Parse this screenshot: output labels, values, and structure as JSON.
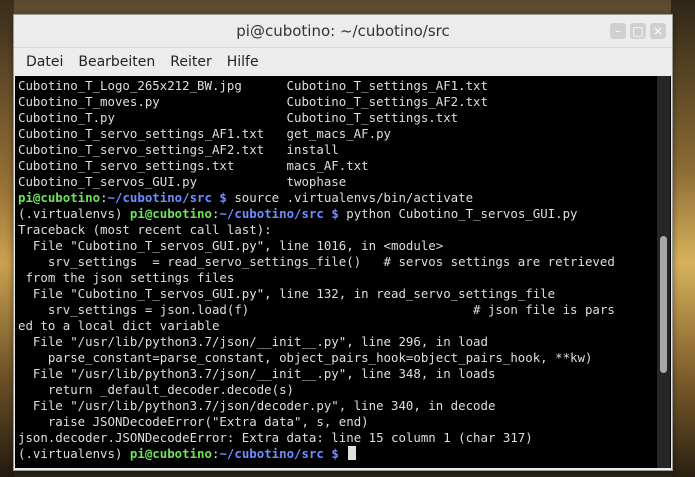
{
  "window": {
    "title": "pi@cubotino: ~/cubotino/src"
  },
  "menu": [
    "Datei",
    "Bearbeiten",
    "Reiter",
    "Hilfe"
  ],
  "terminal": {
    "ls_rows": [
      [
        "Cubotino_T_Logo_265x212_BW.jpg",
        "Cubotino_T_settings_AF1.txt"
      ],
      [
        "Cubotino_T_moves.py",
        "Cubotino_T_settings_AF2.txt"
      ],
      [
        "Cubotino_T.py",
        "Cubotino_T_settings.txt"
      ],
      [
        "Cubotino_T_servo_settings_AF1.txt",
        "get_macs_AF.py"
      ],
      [
        "Cubotino_T_servo_settings_AF2.txt",
        "install"
      ],
      [
        "Cubotino_T_servo_settings.txt",
        "macs_AF.txt"
      ],
      [
        "Cubotino_T_servos_GUI.py",
        "twophase"
      ]
    ],
    "prompt_user": "pi@cubotino",
    "prompt_path": "~/cubotino/src $",
    "venv": "(.virtualenvs)",
    "cmd1": " source .virtualenvs/bin/activate",
    "cmd2": " python Cubotino_T_servos_GUI.py",
    "output": [
      "Traceback (most recent call last):",
      "  File \"Cubotino_T_servos_GUI.py\", line 1016, in <module>",
      "    srv_settings  = read_servo_settings_file()   # servos settings are retrieved",
      " from the json settings files",
      "  File \"Cubotino_T_servos_GUI.py\", line 132, in read_servo_settings_file",
      "    srv_settings = json.load(f)                              # json file is pars",
      "ed to a local dict variable",
      "  File \"/usr/lib/python3.7/json/__init__.py\", line 296, in load",
      "    parse_constant=parse_constant, object_pairs_hook=object_pairs_hook, **kw)",
      "  File \"/usr/lib/python3.7/json/__init__.py\", line 348, in loads",
      "    return _default_decoder.decode(s)",
      "  File \"/usr/lib/python3.7/json/decoder.py\", line 340, in decode",
      "    raise JSONDecodeError(\"Extra data\", s, end)",
      "json.decoder.JSONDecodeError: Extra data: line 15 column 1 (char 317)"
    ],
    "scroll": {
      "position": 0.62,
      "visible_fraction": 0.35
    }
  },
  "colors": {
    "prompt_user": "#6ee25a",
    "prompt_path": "#6d8fff",
    "text": "#dedede",
    "background": "#000000"
  }
}
